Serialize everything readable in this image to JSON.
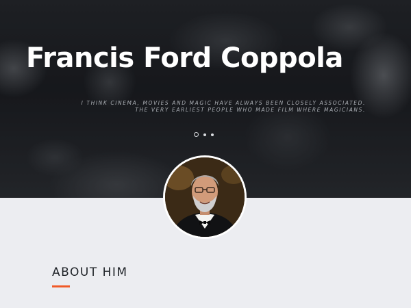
{
  "hero": {
    "title": "Francis Ford Coppola",
    "quote_line1": "I think cinema, movies and magic have always been  closely associated.",
    "quote_line2": "The very earliest people who made film where magicians.",
    "slides": {
      "count": 3,
      "active_index": 0
    }
  },
  "about": {
    "heading": "ABOUT HIM"
  },
  "colors": {
    "accent": "#f05a28",
    "page_background": "#ecedf1",
    "heading_text": "#1f2328"
  },
  "icons": {
    "profile_photo": "portrait-photo"
  }
}
